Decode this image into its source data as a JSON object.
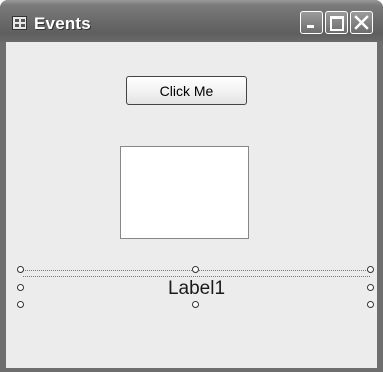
{
  "window": {
    "title": "Events",
    "icon": "form-icon",
    "controls": [
      "minimize-icon",
      "maximize-icon",
      "close-icon"
    ]
  },
  "form": {
    "button_label": "Click Me",
    "label_text": "Label1"
  },
  "colors": {
    "titlebar": "#6a6a6a",
    "client_background": "#ececec",
    "picture_box": "#ffffff"
  }
}
